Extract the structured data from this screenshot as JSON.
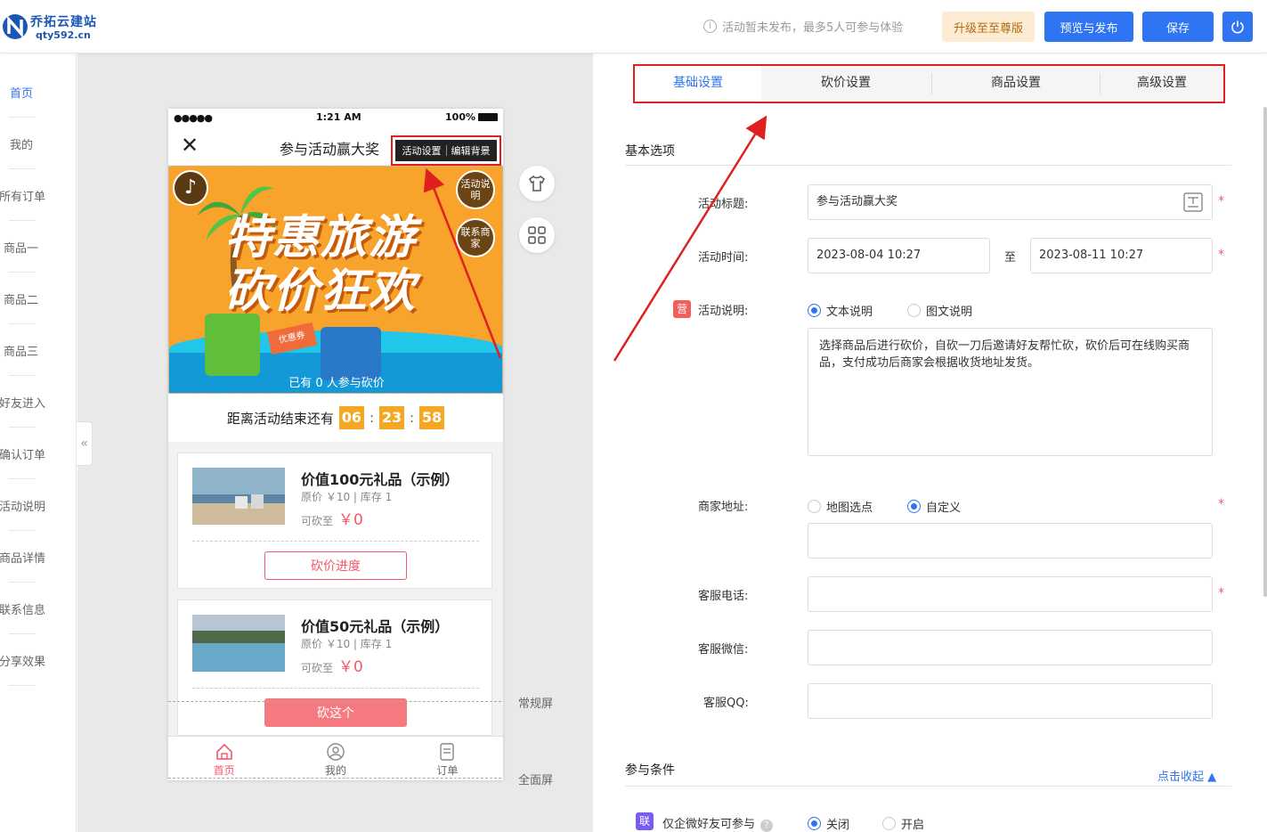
{
  "header": {
    "logo_name": "乔拓云建站",
    "logo_domain": "qty592.cn",
    "notice": "活动暂未发布，最多5人可参与体验",
    "upgrade": "升级至至尊版",
    "preview": "预览与发布",
    "save": "保存"
  },
  "nav": [
    "首页",
    "我的",
    "所有订单",
    "商品一",
    "商品二",
    "商品三",
    "好友进入",
    "确认订单",
    "活动说明",
    "商品详情",
    "联系信息",
    "分享效果"
  ],
  "phone": {
    "status_time": "1:21 AM",
    "status_battery": "100%",
    "status_dots": "●●●●●",
    "title": "参与活动赢大奖",
    "toolbar_activity": "活动设置",
    "toolbar_bg": "编辑背景",
    "banner_line1": "特惠旅游",
    "banner_line2": "砍价狂欢",
    "coupon": "优惠券",
    "bubble_rules": "活动说明",
    "bubble_contact": "联系商家",
    "participants": "已有 0 人参与砍价",
    "countdown_label": "距离活动结束还有",
    "cd_h": "06",
    "cd_m": "23",
    "cd_s": "58",
    "products": [
      {
        "name": "价值100元礼品（示例）",
        "info": "原价 ￥10 | 库存 1",
        "price_label": "可砍至",
        "price": "￥0",
        "button": "砍价进度"
      },
      {
        "name": "价值50元礼品（示例）",
        "info": "原价 ￥10 | 库存 1",
        "price_label": "可砍至",
        "price": "￥0",
        "button": "砍这个"
      }
    ],
    "tabs": [
      "首页",
      "我的",
      "订单"
    ]
  },
  "screen_labels": {
    "normal": "常规屏",
    "full": "全面屏"
  },
  "settings": {
    "tabs": [
      "基础设置",
      "砍价设置",
      "商品设置",
      "高级设置"
    ],
    "section_basic": "基本选项",
    "title_label": "活动标题:",
    "title_value": "参与活动赢大奖",
    "time_label": "活动时间:",
    "time_start": "2023-08-04 10:27",
    "time_to": "至",
    "time_end": "2023-08-11 10:27",
    "desc_badge": "营",
    "desc_label": "活动说明:",
    "desc_opt_text": "文本说明",
    "desc_opt_image": "图文说明",
    "desc_value": "选择商品后进行砍价，自砍一刀后邀请好友帮忙砍，砍价后可在线购买商品，支付成功后商家会根据收货地址发货。",
    "address_label": "商家地址:",
    "address_opt_map": "地图选点",
    "address_opt_custom": "自定义",
    "phone_label": "客服电话:",
    "wechat_label": "客服微信:",
    "qq_label": "客服QQ:",
    "section_cond": "参与条件",
    "collapse": "点击收起",
    "cond_badge": "联",
    "cond_label": "仅企微好友可参与",
    "cond_off": "关闭",
    "cond_on": "开启",
    "required_mark": "*"
  },
  "colors": {
    "primary": "#2f74f2",
    "accent": "#f5576c",
    "highlight": "#e02020"
  }
}
